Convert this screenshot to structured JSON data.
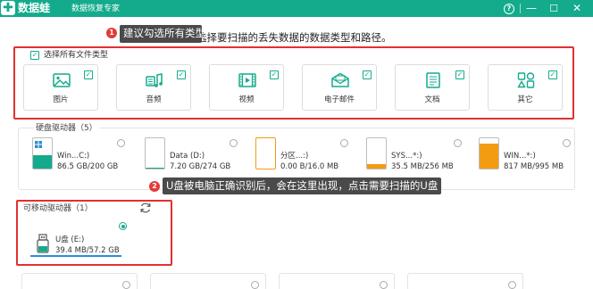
{
  "app": {
    "logo_char": "✚",
    "name": "数据蛙",
    "subtitle": "数据恢复专家"
  },
  "window_controls": {
    "help": "?",
    "minimize": "—",
    "maximize": "☐",
    "close": "✕"
  },
  "instruction": "选择要扫描的丢失数据的数据类型和路径。",
  "tooltips": [
    {
      "number": "1",
      "text": "建议勾选所有类型"
    },
    {
      "number": "2",
      "text": "U盘被电脑正确识别后，会在这里出现，点击需要扫描的U盘"
    }
  ],
  "file_types": {
    "select_all_label": "选择所有文件类型",
    "select_all_checked": true,
    "items": [
      {
        "label": "图片",
        "icon": "image-icon",
        "checked": true
      },
      {
        "label": "音频",
        "icon": "audio-icon",
        "checked": true
      },
      {
        "label": "视频",
        "icon": "video-icon",
        "checked": true
      },
      {
        "label": "电子邮件",
        "icon": "email-icon",
        "checked": true
      },
      {
        "label": "文档",
        "icon": "document-icon",
        "checked": true
      },
      {
        "label": "其它",
        "icon": "other-icon",
        "checked": true
      }
    ]
  },
  "hard_drives": {
    "label": "硬盘驱动器（5）",
    "items": [
      {
        "name": "Win...C:)",
        "size": "86.5 GB/200 GB",
        "fill_fraction": 0.43,
        "fill_color": "#14aa8c",
        "icon": "windows-drive-icon"
      },
      {
        "name": "Data (D:)",
        "size": "7.20 GB/274 GB",
        "fill_fraction": 0.03,
        "fill_color": "#14aa8c",
        "icon": "drive-icon"
      },
      {
        "name": "分区...:)",
        "size": "0.00  B/16.0 MB",
        "fill_fraction": 0.0,
        "fill_color": "#f39c12",
        "icon": "drive-icon"
      },
      {
        "name": "SYS...*:)",
        "size": "35.5 MB/256 MB",
        "fill_fraction": 0.14,
        "fill_color": "#f39c12",
        "icon": "drive-icon"
      },
      {
        "name": "WIN...*:)",
        "size": "817 MB/995 MB",
        "fill_fraction": 0.82,
        "fill_color": "#f39c12",
        "icon": "drive-icon"
      }
    ]
  },
  "removable": {
    "label": "可移动驱动器（1）",
    "items": [
      {
        "name": "U盘 (E:)",
        "size": "39.4 MB/57.2 GB",
        "selected": true,
        "icon": "usb-icon"
      }
    ]
  },
  "colors": {
    "brand": "#14aa8c",
    "highlight_border": "#e23030",
    "warning_fill": "#f39c12",
    "selection_bar": "#2a8fd6"
  }
}
